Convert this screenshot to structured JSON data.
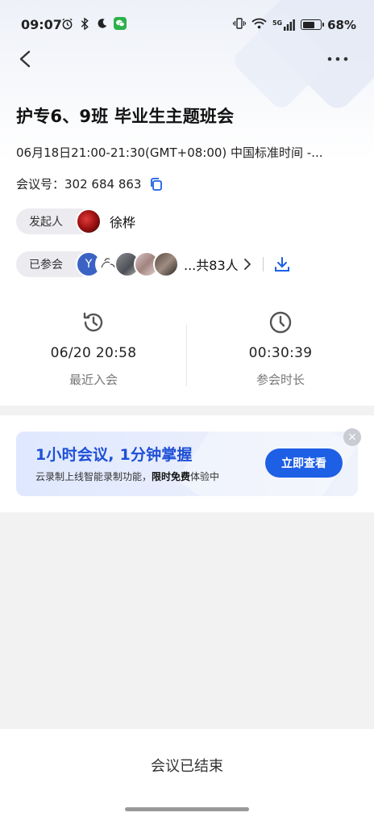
{
  "status_bar": {
    "time": "09:07",
    "battery": "68%",
    "battery_level": 0.68,
    "left_icons": [
      "alarm-icon",
      "bluetooth-icon",
      "moon-icon",
      "wechat-icon"
    ],
    "right_icons": [
      "vibrate-icon",
      "wifi-icon",
      "5g-signal-icon",
      "battery-icon"
    ],
    "network_label": "5G"
  },
  "nav": {
    "back_icon": "chevron-left-icon",
    "more_icon": "more-dots-icon"
  },
  "meeting": {
    "title": "护专6、9班 毕业生主题班会",
    "time": "06月18日21:00-21:30(GMT+08:00) 中国标准时间 -...",
    "id_label": "会议号：",
    "id_value": "302 684 863",
    "host_label": "发起人",
    "host_name": "徐桦",
    "attended_label": "已参会",
    "attendee_initial": "Y",
    "attendee_total": "...共83人"
  },
  "stats": {
    "recent_join_value": "06/20 20:58",
    "recent_join_label": "最近入会",
    "duration_value": "00:30:39",
    "duration_label": "参会时长"
  },
  "banner": {
    "title": "1小时会议, 1分钟掌握",
    "subtitle_prefix": "云录制上线智能录制功能，",
    "subtitle_bold": "限时免费",
    "subtitle_suffix": "体验中",
    "button_label": "立即查看",
    "close_label": "×"
  },
  "footer": {
    "status": "会议已结束"
  },
  "colors": {
    "accent": "#1d5fe5",
    "banner_title": "#1e4fd6",
    "avatar_y": "#3b63c4"
  }
}
